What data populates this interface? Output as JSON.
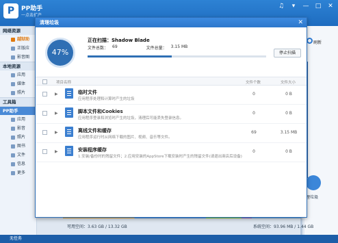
{
  "app": {
    "logo_letter": "P",
    "title": "PP助手",
    "subtitle": "一点击扩产",
    "window_buttons": [
      "♫",
      "▾",
      "—",
      "□",
      "✕"
    ]
  },
  "sidebar": {
    "groups": [
      {
        "label": "网络资源",
        "items": [
          {
            "label": "越狱助",
            "active": true
          },
          {
            "label": "正版应"
          },
          {
            "label": "影音图"
          }
        ]
      },
      {
        "label": "本地资源",
        "items": [
          {
            "label": "应用"
          },
          {
            "label": "媒体"
          },
          {
            "label": "照片"
          }
        ]
      },
      {
        "label": "工具箱",
        "items": []
      },
      {
        "label": "PP助手",
        "items": [
          {
            "label": "应用"
          },
          {
            "label": "影音"
          },
          {
            "label": "照片"
          },
          {
            "label": "图书"
          },
          {
            "label": "文件"
          },
          {
            "label": "信息"
          },
          {
            "label": "更多"
          }
        ]
      }
    ],
    "status": "无任务"
  },
  "right": {
    "refresh_label": "刷新",
    "clean_label": "理垃圾"
  },
  "storage": {
    "available": "可用空间：",
    "available_value": "3.63 GB / 13.32 GB",
    "system": "系统空间：",
    "system_value": "93.96 MB / 1.44 GB"
  },
  "dialog": {
    "title": "清理垃圾",
    "progress_percent": 47,
    "progress_label": "47%",
    "scan_status": "正在扫描：Shadow Blade",
    "file_count_label": "文件总数：",
    "file_count": "69",
    "file_size_label": "文件总量：",
    "file_size": "3.15 MB",
    "stop_button": "停止扫描",
    "columns": {
      "name": "项目名称",
      "count": "文件个数",
      "size": "文件大小"
    },
    "rows": [
      {
        "title": "临时文件",
        "desc": "应用程序处理和计算时产生的垃圾",
        "count": "0",
        "size": "0 B"
      },
      {
        "title": "脚本文件和Cookies",
        "desc": "应用程序登录和浏览时产生的垃圾，清理后可能丢失登录信息。",
        "count": "0",
        "size": "0 B"
      },
      {
        "title": "离线文件和缓存",
        "desc": "应用程序运行时从网络下载的图片、视频、音乐等文件。",
        "count": "69",
        "size": "3.15 MB"
      },
      {
        "title": "安装程序缓存",
        "desc": "1.安装/备份时的残留文件；2.应用安装的AppStore下载安装时产生的残留文件(请退出商店后设备)",
        "count": "0",
        "size": "0 B"
      }
    ]
  }
}
